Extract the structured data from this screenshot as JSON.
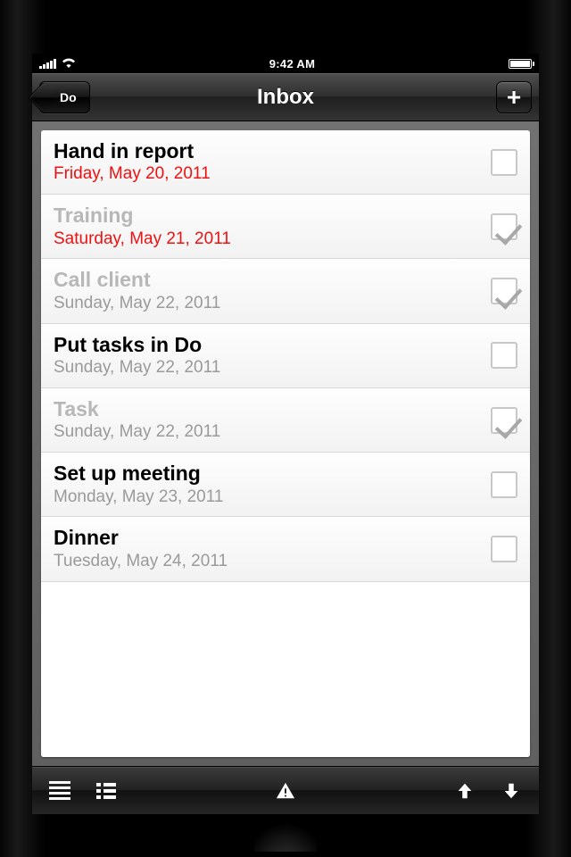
{
  "statusbar": {
    "time": "9:42 AM"
  },
  "nav": {
    "back_label": "Do",
    "title": "Inbox",
    "add_glyph": "+"
  },
  "tasks": [
    {
      "title": "Hand in report",
      "date": "Friday, May 20, 2011",
      "done": false,
      "overdue": true
    },
    {
      "title": "Training",
      "date": "Saturday, May 21, 2011",
      "done": true,
      "overdue": true
    },
    {
      "title": "Call client",
      "date": "Sunday, May 22, 2011",
      "done": true,
      "overdue": false
    },
    {
      "title": "Put tasks in Do",
      "date": "Sunday, May 22, 2011",
      "done": false,
      "overdue": false
    },
    {
      "title": "Task",
      "date": "Sunday, May 22, 2011",
      "done": true,
      "overdue": false
    },
    {
      "title": "Set up meeting",
      "date": "Monday, May 23, 2011",
      "done": false,
      "overdue": false
    },
    {
      "title": "Dinner",
      "date": "Tuesday, May 24, 2011",
      "done": false,
      "overdue": false
    }
  ]
}
